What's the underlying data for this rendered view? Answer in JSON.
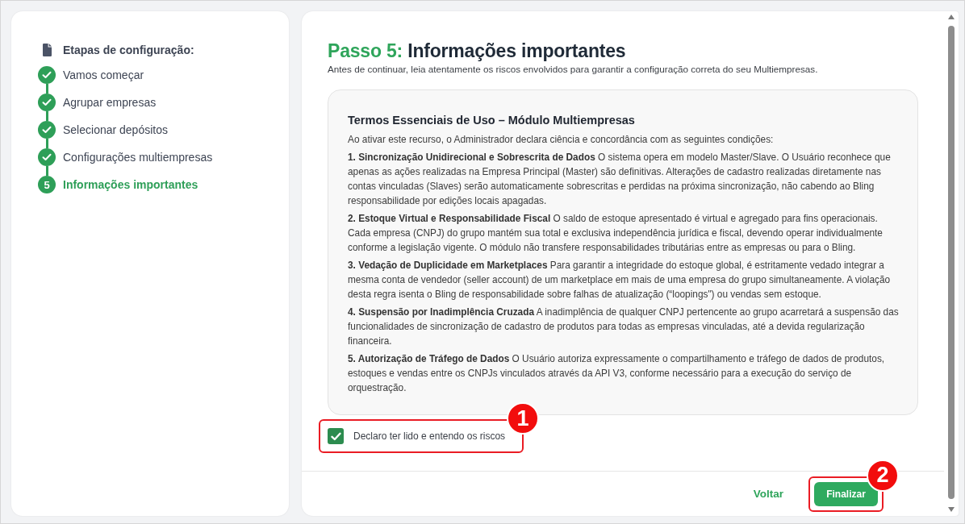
{
  "sidebar": {
    "header": "Etapas de configuração:",
    "steps": [
      {
        "label": "Vamos começar",
        "completed": true,
        "selected": false
      },
      {
        "label": "Agrupar empresas",
        "completed": true,
        "selected": false
      },
      {
        "label": "Selecionar depósitos",
        "completed": true,
        "selected": false
      },
      {
        "label": "Configurações multiempresas",
        "completed": true,
        "selected": false
      },
      {
        "label": "Informações importantes",
        "number": "5",
        "completed": false,
        "selected": true
      }
    ]
  },
  "title": {
    "prefix": "Passo 5:",
    "text": "Informações importantes"
  },
  "subtitle": "Antes de continuar, leia atentamente os riscos envolvidos para garantir a configuração correta do seu Multiempresas.",
  "terms": {
    "heading": "Termos Essenciais de Uso – Módulo Multiempresas",
    "intro": "Ao ativar este recurso, o Administrador declara ciência e concordância com as seguintes condições:",
    "clauses": [
      {
        "title": "1. Sincronização Unidirecional e Sobrescrita de Dados",
        "text": "O sistema opera em modelo Master/Slave. O Usuário reconhece que apenas as ações realizadas na Empresa Principal (Master) são definitivas. Alterações de cadastro realizadas diretamente nas contas vinculadas (Slaves) serão automaticamente sobrescritas e perdidas na próxima sincronização, não cabendo ao Bling responsabilidade por edições locais apagadas."
      },
      {
        "title": "2. Estoque Virtual e Responsabilidade Fiscal",
        "text": "O saldo de estoque apresentado é virtual e agregado para fins operacionais. Cada empresa (CNPJ) do grupo mantém sua total e exclusiva independência jurídica e fiscal, devendo operar individualmente conforme a legislação vigente. O módulo não transfere responsabilidades tributárias entre as empresas ou para o Bling."
      },
      {
        "title": "3. Vedação de Duplicidade em Marketplaces",
        "text": "Para garantir a integridade do estoque global, é estritamente vedado integrar a mesma conta de vendedor (seller account) de um marketplace em mais de uma empresa do grupo simultaneamente. A violação desta regra isenta o Bling de responsabilidade sobre falhas de atualização (“loopings\") ou vendas sem estoque."
      },
      {
        "title": "4. Suspensão por Inadimplência Cruzada",
        "text": "A inadimplência de qualquer CNPJ pertencente ao grupo acarretará a suspensão das funcionalidades de sincronização de cadastro de produtos para todas as empresas vinculadas, até a devida regularização financeira."
      },
      {
        "title": "5. Autorização de Tráfego de Dados",
        "text": "O Usuário autoriza expressamente o compartilhamento e tráfego de dados de produtos, estoques e vendas entre os CNPJs vinculados através da API V3, conforme necessário para a execução do serviço de orquestração."
      }
    ]
  },
  "consent": {
    "label": "Declaro ter lido e entendo os riscos",
    "checked": true,
    "annotation": "1"
  },
  "footer_buttons": [
    {
      "kind": "link",
      "label": "Voltar"
    },
    {
      "kind": "primary",
      "label": "Finalizar",
      "annotation": "2"
    }
  ]
}
